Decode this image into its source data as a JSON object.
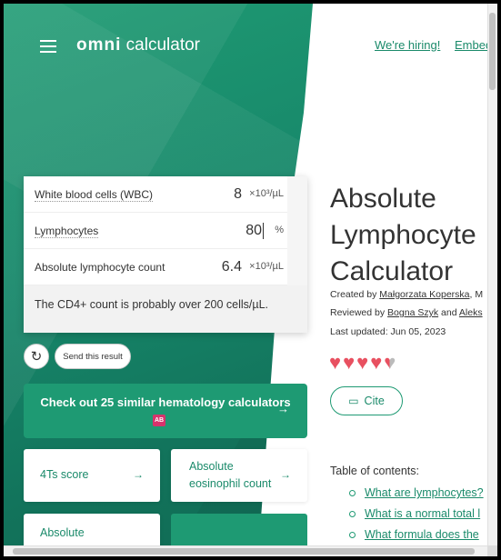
{
  "header": {
    "logo_omni": "omni",
    "logo_text": "calculator",
    "hiring_link": "We're hiring!",
    "embed_link": "Embed"
  },
  "calculator": {
    "fields": [
      {
        "label": "White blood cells (WBC)",
        "value": "8",
        "unit": "×10³/µL"
      },
      {
        "label": "Lymphocytes",
        "value": "80",
        "unit": "%"
      },
      {
        "label": "Absolute lymphocyte count",
        "value": "6.4",
        "unit": "×10³/µL"
      }
    ],
    "message": "The CD4+ count is probably over 200 cells/µL."
  },
  "actions": {
    "refresh_icon": "↻",
    "send_label": "Send this result"
  },
  "similar": {
    "label": "Check out 25 similar hematology calculators",
    "badge": "AB"
  },
  "tiles": [
    {
      "label": "4Ts score"
    },
    {
      "label_line1": "Absolute",
      "label_line2": "eosinophil count"
    },
    {
      "label": "Absolute"
    }
  ],
  "article": {
    "title_line1": "Absolute",
    "title_line2": "Lymphocyte",
    "title_line3": "Calculator",
    "created_prefix": "Created by",
    "created_author": "Małgorzata Koperska",
    "created_suffix": ", M",
    "reviewed_prefix": "Reviewed by",
    "reviewer1": "Bogna Szyk",
    "reviewed_and": "and",
    "reviewer2": "Aleks",
    "updated": "Last updated: Jun 05, 2023",
    "rating_full": 4,
    "rating_half": true,
    "cite_label": "Cite"
  },
  "toc": {
    "heading": "Table of contents:",
    "items": [
      "What are lymphocytes?",
      "What is a normal total l",
      "What formula does the"
    ]
  },
  "colors": {
    "brand_green": "#1e9a73",
    "link_green": "#1a8a6a",
    "heart_red": "#e85060"
  }
}
